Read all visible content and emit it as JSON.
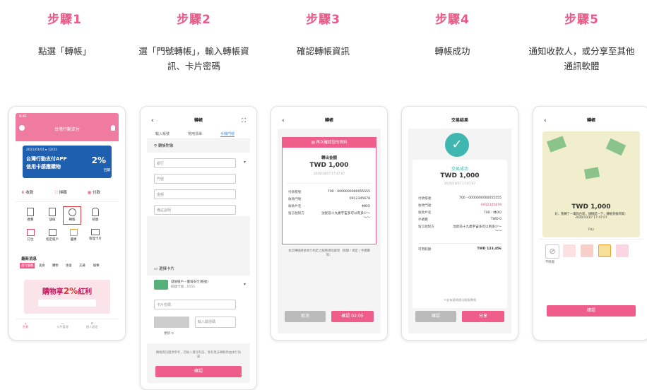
{
  "steps": [
    {
      "title": "步驟1",
      "desc": "點選「轉帳」"
    },
    {
      "title": "步驟2",
      "desc": "選「門號轉帳」，輸入轉帳資訊、卡片密碼"
    },
    {
      "title": "步驟3",
      "desc": "確認轉帳資訊"
    },
    {
      "title": "步驟4",
      "desc": "轉帳成功"
    },
    {
      "title": "步驟5",
      "desc": "通知收款人，或分享至其他通訊軟體"
    }
  ],
  "s1": {
    "status_time": "9:41",
    "app_title": "台灣行動支付",
    "banner_date": "2021/01/01 ▸ 12/31",
    "banner_line1": "台灣行動支付APP",
    "banner_line2": "信用卡感應購物",
    "banner_badge": "2%",
    "banner_badge_sub": "回饋",
    "actions": [
      "收款",
      "掃碼",
      "付款"
    ],
    "grid": [
      "繳費",
      "儲值",
      "轉帳",
      "餘額",
      "訂位",
      "指定帳戶",
      "優惠",
      "管理卡片"
    ],
    "news_title": "最新消息",
    "news_tabs": [
      "進行優惠",
      "美食",
      "購物",
      "住宿",
      "交通",
      "娛樂"
    ],
    "promo_main": "購物享",
    "promo_pct": "2%",
    "promo_tail": "紅利",
    "bottom_nav": [
      "首頁",
      "卡片管理",
      "個人設定"
    ]
  },
  "s2": {
    "title": "轉帳",
    "tabs": [
      "輸入帳號",
      "常用清單",
      "手機門號"
    ],
    "section1": "轉帳對象",
    "f_bank": "銀行",
    "f_phone": "門號",
    "f_amount": "金額",
    "f_note": "備註說明",
    "section2": "選擇卡片",
    "card_name": "儲值帳戶－臺灣支付(帳號)",
    "card_num": "餘額卡號…5555",
    "f_pin": "卡片密碼",
    "f_captcha": "輸入驗證碼",
    "refresh": "更新",
    "footnote": "轉帳資訊僅供參考，若輸入資訊有誤，致有無法轉帳時由本行負責",
    "btn": "確認"
  },
  "s3": {
    "title": "轉帳",
    "confirm_header": "再次確認您的資料",
    "label": "轉出金額",
    "amount": "TWD 1,000",
    "date": "2020/10/07 17:47:07",
    "rows": [
      [
        "付款帳號",
        "700 - 0000000000055555"
      ],
      [
        "收款門號",
        "0912345678"
      ],
      [
        "收款戶名",
        "林OO"
      ],
      [
        "留言給對方",
        "沈從前十九歲宇宙多可以有多少～～～"
      ]
    ],
    "notice": "本次轉帳將依本行約定之服務規則處理（限額 / 規定 / 手續費等）",
    "btn_cancel": "取消",
    "btn_ok": "確認 02:05"
  },
  "s4": {
    "title": "交易結果",
    "status": "交易成功",
    "amount": "TWD 1,000",
    "date": "2020/10/07 17:47:07",
    "rows": [
      [
        "付款帳號",
        "700 - 0000000000055555"
      ],
      [
        "收款門號",
        "0912345678"
      ],
      [
        "收款戶名",
        "700 - 林OO"
      ],
      [
        "手續費",
        "TWD 0"
      ],
      [
        "留言給對方",
        "沈從前十九歲宇宙多可以到多少～～～"
      ],
      [
        "可用餘額",
        "TWD 123,456"
      ]
    ],
    "footer": "＊若有疑問請洽客服專線",
    "btn_ok": "確認",
    "btn_share": "分享"
  },
  "s5": {
    "title": "轉帳",
    "amount": "TWD 1,000",
    "msg": "好，我轉了一筆款台新，請確認一下，轉帳到帳時間：2020/10/07 17:47:07",
    "brand": "Pay",
    "icon_label": "不附圖",
    "btn": "確認"
  },
  "colors": {
    "accent": "#ea5a87",
    "button": "#ef5d8b",
    "success": "#3fb6b0"
  }
}
